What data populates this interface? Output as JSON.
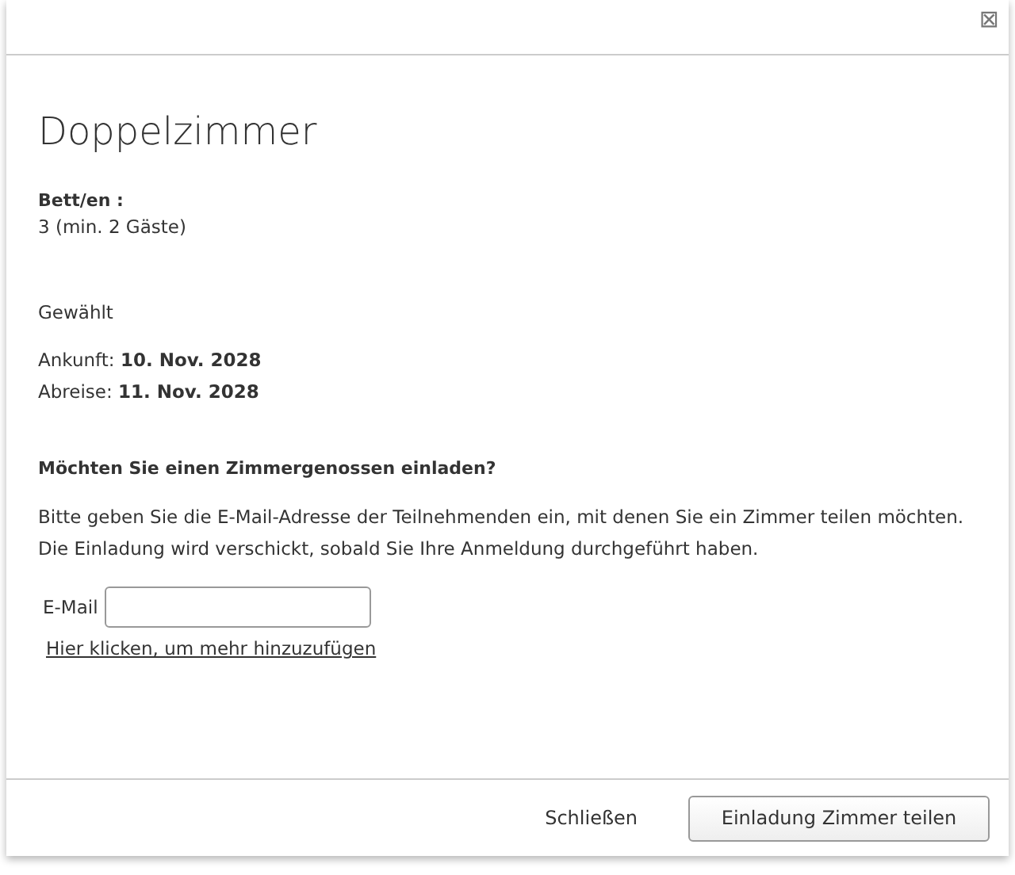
{
  "dialog": {
    "close_icon": "⊠",
    "title": "Doppelzimmer",
    "beds": {
      "label": "Bett/en :",
      "value": "3 (min. 2 Gäste)"
    },
    "selected_label": "Gewählt",
    "dates": [
      "Ankunft: **10. Nov. 2028**",
      "Abreise: **11. Nov. 2028**"
    ],
    "invite": {
      "heading": "Möchten Sie einen Zimmergenossen einladen?",
      "paragraphs": [
        "Bitte geben Sie die E-Mail-Adresse der Teilnehmenden ein, mit denen Sie ein Zimmer teilen möchten.",
        "Die Einladung wird verschickt, sobald Sie Ihre Anmeldung durchgeführt haben."
      ],
      "email_label": "E-Mail",
      "add_more_link": "Hier klicken, um mehr hinzuzufügen"
    },
    "buttons": [
      {
        "label": "Schließen",
        "kind": "plain"
      },
      {
        "label": "Einladung Zimmer teilen",
        "kind": "outlined"
      }
    ]
  }
}
